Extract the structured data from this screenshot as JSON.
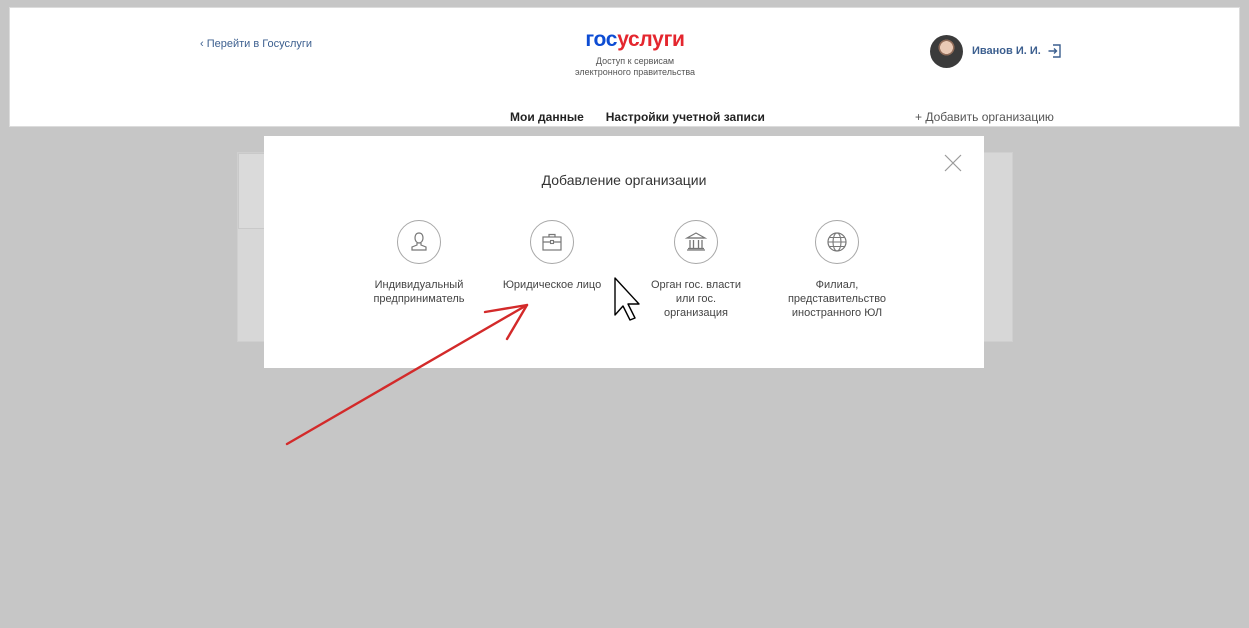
{
  "header": {
    "back_link": "Перейти в Госуслуги",
    "logo_part1": "гос",
    "logo_part2": "услуги",
    "tagline_line1": "Доступ к сервисам",
    "tagline_line2": "электронного правительства",
    "user_name": "Иванов  И. И.",
    "logout_icon": "logout-icon"
  },
  "nav": {
    "items": [
      "Мои данные",
      "Настройки учетной записи"
    ],
    "add_org": "+ Добавить организацию"
  },
  "modal": {
    "title": "Добавление организации",
    "close_icon": "close-icon",
    "options": [
      {
        "label": "Индивидуальный\nпредприниматель",
        "icon": "person-icon"
      },
      {
        "label": "Юридическое лицо",
        "icon": "briefcase-icon"
      },
      {
        "label": "Орган гос. власти\nили гос.\nорганизация",
        "icon": "government-building-icon"
      },
      {
        "label": "Филиал,\nпредставительство\nиностранного ЮЛ",
        "icon": "globe-icon"
      }
    ]
  },
  "colors": {
    "brand_blue": "#0d4cd3",
    "brand_red": "#e4262e",
    "link_blue": "#3c5f8f",
    "annotation_arrow": "#d32a2a",
    "backdrop": "#c6c6c6"
  }
}
